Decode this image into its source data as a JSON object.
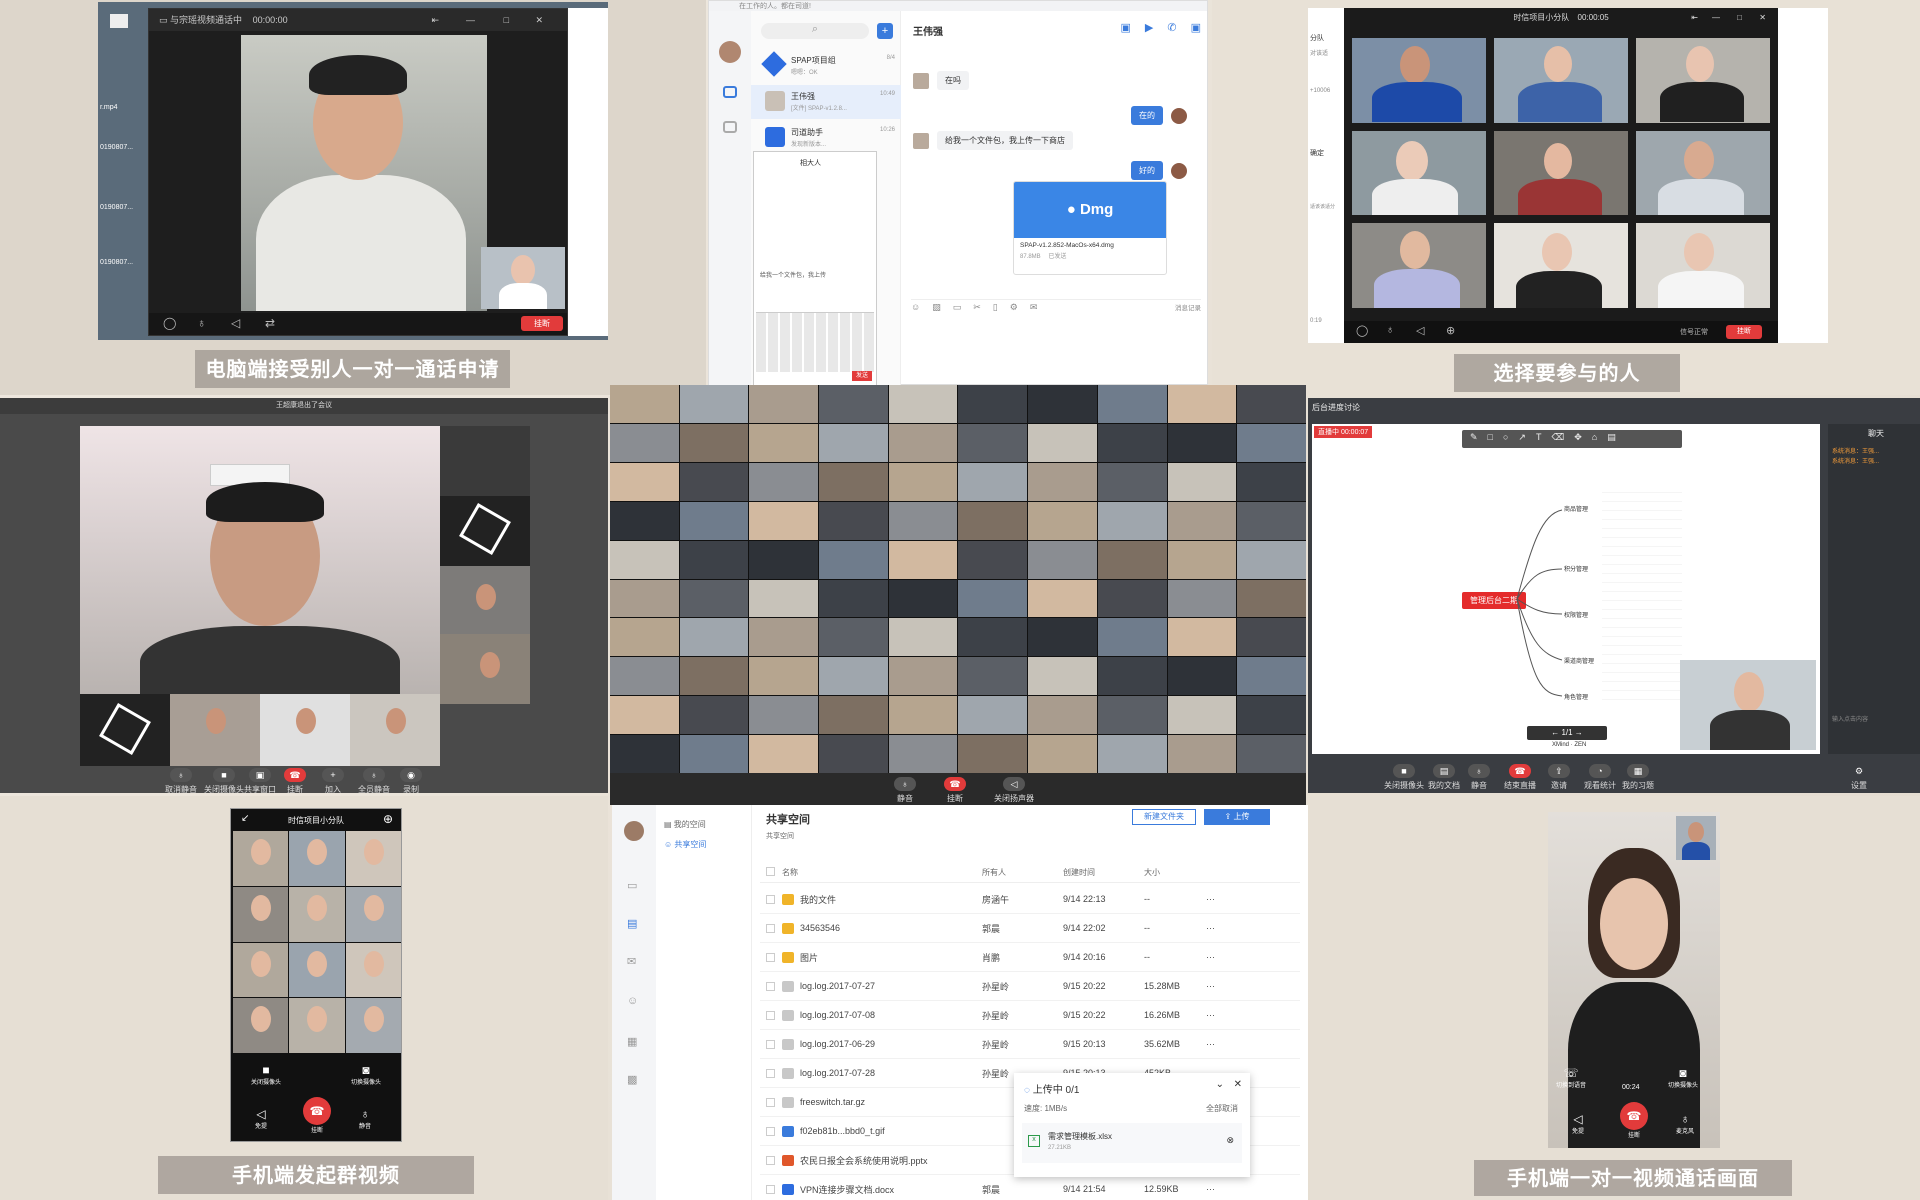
{
  "captions": {
    "p1": "电脑端接受别人一对一通话申请",
    "p3": "选择要参与的人",
    "p7": "手机端发起群视频",
    "p9": "手机端一对一视频通话画面"
  },
  "p1": {
    "title": "与宗瑶视频通话中",
    "timer": "00:00:00",
    "hangup": "挂断",
    "desktop_files": [
      "0190807...",
      "0190807...",
      "0190807...",
      "r.mp4"
    ]
  },
  "p2": {
    "banner": "在工作的人。都在司道!",
    "search_placeholder": "",
    "contacts": [
      {
        "name": "SPAP项目组",
        "sub": "嗯嗯：OK",
        "time": "8/4"
      },
      {
        "name": "王伟强",
        "sub": "[文件] SPAP-v1.2.8...",
        "time": "10:49"
      },
      {
        "name": "司道助手",
        "sub": "发现新版本...",
        "time": "10:26"
      }
    ],
    "chat_title": "王伟强",
    "messages": [
      {
        "side": "left",
        "text": "在吗"
      },
      {
        "side": "right",
        "text": "在的"
      },
      {
        "side": "left",
        "text": "给我一个文件包，我上传一下商店"
      },
      {
        "side": "right",
        "text": "好的"
      }
    ],
    "file_card": {
      "brand": "Dmg",
      "name": "SPAP-v1.2.852-MacOs-x64.dmg",
      "size": "87.8MB",
      "status": "已发送"
    },
    "history": "消息记录",
    "phone_header": "相大人",
    "phone_hint": "给我一个文件包，我上传",
    "send": "发送"
  },
  "p3": {
    "title": "时信项目小分队",
    "timer": "00:00:05",
    "signal": "信号正常",
    "hangup": "挂断",
    "left_texts": [
      "分队",
      "对该适",
      "+10006",
      "确定",
      "适该该适分",
      "0:19"
    ]
  },
  "p4": {
    "title": "王超康退出了会议",
    "controls": [
      "取消静音",
      "关闭摄像头",
      "共享窗口",
      "挂断",
      "加入",
      "全员静音",
      "录制"
    ]
  },
  "p5": {
    "controls": [
      "静音",
      "挂断",
      "关闭扬声器"
    ]
  },
  "p6": {
    "title": "后台进度讨论",
    "live": "直播中",
    "timer": "00:00:07",
    "chat_title": "聊天",
    "chat_msgs": [
      "系统消息：王强...",
      "系统消息：王强..."
    ],
    "chat_input": "输入点击内容",
    "mindmap_root": "管理后台二期",
    "mindmap_branches": [
      "商品管理",
      "积分管理",
      "权限管理",
      "渠道商管理",
      "角色管理"
    ],
    "pager": "1/1",
    "brand": "XMind · ZEN",
    "controls": [
      "关闭摄像头",
      "我的文档",
      "静音",
      "结束直播",
      "邀请",
      "观看统计",
      "我的习题",
      "设置"
    ]
  },
  "p7": {
    "title": "时信项目小分队",
    "controls_top": [
      "关闭摄像头",
      "切换摄像头"
    ],
    "controls_bottom": [
      "免提",
      "挂断",
      "静音"
    ]
  },
  "p8": {
    "nav": [
      "我的空间",
      "共享空间"
    ],
    "title": "共享空间",
    "breadcrumb": "共享空间",
    "new_folder": "新建文件夹",
    "upload": "上传",
    "columns": [
      "名称",
      "所有人",
      "创建时间",
      "大小"
    ],
    "rows": [
      {
        "name": "我的文件",
        "owner": "房涵午",
        "time": "9/14  22:13",
        "size": "--",
        "type": "folder"
      },
      {
        "name": "34563546",
        "owner": "郭晨",
        "time": "9/14  22:02",
        "size": "--",
        "type": "folder"
      },
      {
        "name": "图片",
        "owner": "肖鹏",
        "time": "9/14  20:16",
        "size": "--",
        "type": "folder"
      },
      {
        "name": "log.log.2017-07-27",
        "owner": "孙星岭",
        "time": "9/15  20:22",
        "size": "15.28MB",
        "type": "file"
      },
      {
        "name": "log.log.2017-07-08",
        "owner": "孙星岭",
        "time": "9/15  20:22",
        "size": "16.26MB",
        "type": "file"
      },
      {
        "name": "log.log.2017-06-29",
        "owner": "孙星岭",
        "time": "9/15  20:13",
        "size": "35.62MB",
        "type": "file"
      },
      {
        "name": "log.log.2017-07-28",
        "owner": "孙星岭",
        "time": "9/15  20:13",
        "size": "452KB",
        "type": "file"
      },
      {
        "name": "freeswitch.tar.gz",
        "owner": "",
        "time": "",
        "size": "",
        "type": "file"
      },
      {
        "name": "f02eb81b...bbd0_t.gif",
        "owner": "",
        "time": "",
        "size": "",
        "type": "img"
      },
      {
        "name": "农民日报全会系统使用说明.pptx",
        "owner": "",
        "time": "",
        "size": "",
        "type": "ppt"
      },
      {
        "name": "VPN连接步骤文档.docx",
        "owner": "郭晨",
        "time": "9/14  21:54",
        "size": "12.59KB",
        "type": "doc"
      }
    ],
    "upload_panel": {
      "status": "上传中 0/1",
      "speed": "速度: 1MB/s",
      "cancel_all": "全部取消",
      "file": "需求管理模板.xlsx",
      "file_size": "27.21KB"
    }
  },
  "p9": {
    "timer": "00:24",
    "controls_top": [
      "切换到语音",
      "切换摄像头"
    ],
    "controls_bottom": [
      "免提",
      "挂断",
      "麦克风"
    ]
  }
}
